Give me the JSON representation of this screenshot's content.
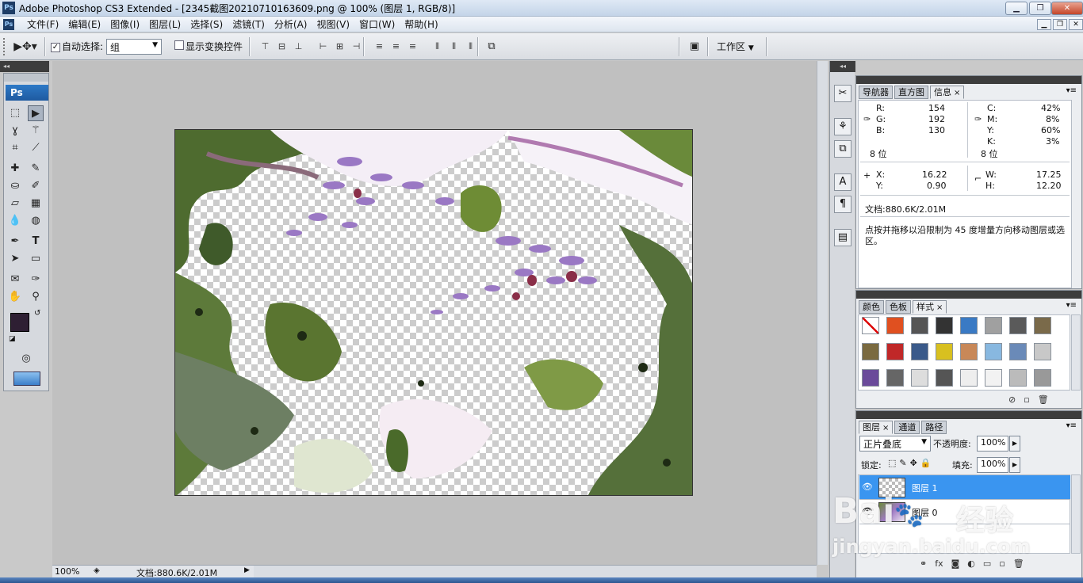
{
  "window": {
    "title": "Adobe Photoshop CS3 Extended - [2345截图20210710163609.png @ 100% (图层 1, RGB/8)]",
    "app_icon": "Ps",
    "min_label": "▁",
    "max_label": "❐",
    "close_label": "✕"
  },
  "menubar": {
    "items": [
      "文件(F)",
      "编辑(E)",
      "图像(I)",
      "图层(L)",
      "选择(S)",
      "滤镜(T)",
      "分析(A)",
      "视图(V)",
      "窗口(W)",
      "帮助(H)"
    ]
  },
  "options": {
    "auto_select_label": "自动选择:",
    "auto_select_value": "组",
    "show_transform_label": "显示变换控件",
    "workspace_label": "工作区"
  },
  "toolbox": {
    "logo": "Ps"
  },
  "document": {
    "zoom": "100%",
    "status": "文档:880.6K/2.01M"
  },
  "info_panel": {
    "tabs": [
      "导航器",
      "直方图",
      "信息"
    ],
    "active_tab": "信息",
    "R": "154",
    "G": "192",
    "B": "130",
    "C": "42%",
    "M": "8%",
    "Y": "60%",
    "K": "3%",
    "bits_left": "8 位",
    "bits_right": "8 位",
    "X": "16.22",
    "Ypos": "0.90",
    "W": "17.25",
    "H": "12.20",
    "doc": "文档:880.6K/2.01M",
    "hint": "点按并拖移以沿限制为 45 度增量方向移动图层或选区。",
    "labels": {
      "R": "R:",
      "G": "G:",
      "B": "B:",
      "C": "C:",
      "M": "M:",
      "Y": "Y:",
      "K": "K:",
      "X": "X:",
      "Yl": "Y:",
      "W": "W:",
      "H": "H:"
    }
  },
  "styles_panel": {
    "tabs": [
      "颜色",
      "色板",
      "样式"
    ],
    "active_tab": "样式",
    "swatch_colors": [
      "#ffffff",
      "#e05020",
      "#555555",
      "#333333",
      "#3a7ac4",
      "#a0a0a0",
      "#5a5a5a",
      "#7a6a4a",
      "#7a6a40",
      "#c02828",
      "#3a5a8a",
      "#d8c020",
      "#c88858",
      "#88b8e0",
      "#6a8ab8",
      "#c8c8c8",
      "#6a4a9a",
      "#666666",
      "#dddddd",
      "#555555",
      "#eeeeee",
      "#f2f2f2",
      "#bbbbbb",
      "#999999"
    ]
  },
  "layers_panel": {
    "tabs": [
      "图层",
      "通道",
      "路径"
    ],
    "active_tab": "图层",
    "blend_mode": "正片叠底",
    "opacity_label": "不透明度:",
    "opacity": "100%",
    "lock_label": "锁定:",
    "fill_label": "填充:",
    "fill": "100%",
    "layers": [
      {
        "name": "图层 1",
        "selected": true
      },
      {
        "name": "图层 0",
        "selected": false
      }
    ]
  },
  "watermark": {
    "main": "Bai",
    "brand": "经验",
    "url": "jingyan.baidu.com"
  },
  "colors": {
    "foreground": "#2e1f33",
    "background": "#ffffff",
    "selection": "#3a95f0"
  }
}
